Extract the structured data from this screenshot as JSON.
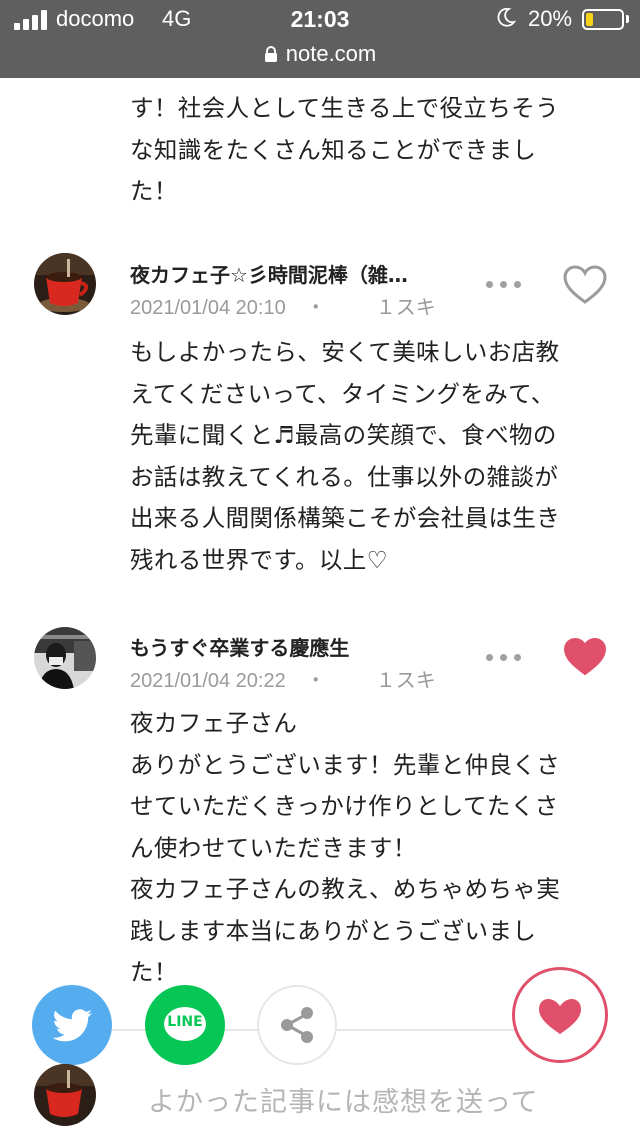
{
  "status_bar": {
    "carrier": "docomo",
    "network": "4G",
    "time": "21:03",
    "battery_percent": "20%",
    "battery_level": 0.2,
    "url": "note.com",
    "icons": [
      "signal-icon",
      "moon-icon",
      "battery-icon",
      "lock-icon"
    ]
  },
  "comments": [
    {
      "lines": [
        "す！社会人として生きる上で役立ちそう",
        "な知識をたくさん知ることができまし",
        "た！"
      ]
    },
    {
      "author": "夜カフェ子☆彡時間泥棒（雑…",
      "date": "2021/01/04 20:10",
      "separator": "・",
      "likes": "１スキ",
      "liked": false,
      "lines": [
        "もしよかったら、安くて美味しいお店教",
        "えてくださいって、タイミングをみて、",
        "先輩に聞くと♬最高の笑顔で、食べ物の",
        "お話は教えてくれる。仕事以外の雑談が",
        "出来る人間関係構築こそが会社員は生き",
        "残れる世界です。以上♡"
      ]
    },
    {
      "author": "もうすぐ卒業する慶應生",
      "date": "2021/01/04 20:22",
      "separator": "・",
      "likes": "１スキ",
      "liked": true,
      "lines": [
        "夜カフェ子さん",
        "ありがとうございます！先輩と仲良くさ",
        "せていただくきっかけ作りとしてたくさ",
        "ん使わせていただきます！",
        "夜カフェ子さんの教え、めちゃめちゃ実",
        "践します本当にありがとうございまし",
        "た！"
      ]
    }
  ],
  "share_bar": {
    "line_label": "LINE",
    "twitter_color": "#55acee",
    "line_color": "#06c755",
    "like_color": "#e0506a"
  },
  "compose": {
    "placeholder": "よかった記事には感想を送って"
  }
}
